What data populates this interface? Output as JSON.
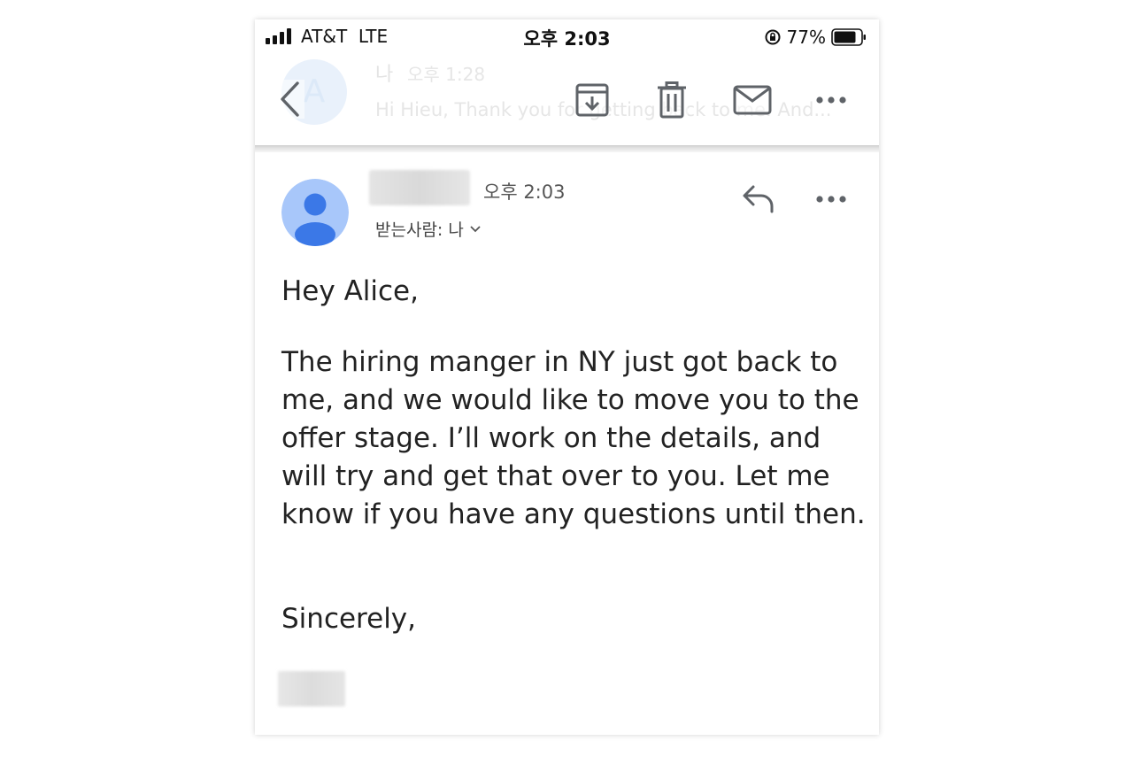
{
  "status_bar": {
    "carrier": "AT&T  LTE",
    "time": "오후 2:03",
    "battery_percent": "77%"
  },
  "toolbar": {
    "background_message": {
      "avatar_letter": "A",
      "sender": "나",
      "time": "오후 1:28",
      "snippet": "Hi Hieu, Thank you for getting back to me. And..."
    },
    "icons": [
      "back-icon",
      "archive-icon",
      "delete-icon",
      "mail-icon",
      "more-icon"
    ]
  },
  "message": {
    "time": "오후 2:03",
    "recipient_label": "받는사람: 나",
    "greeting": "Hey Alice,",
    "body": "The hiring manger in NY just got back to me, and we would like to move you to the offer stage. I’ll work on the details, and will try and get that over to you. Let me know if you have any questions until then.",
    "closing": "Sincerely,"
  },
  "colors": {
    "avatar_bg": "#a8c7fa",
    "avatar_fg": "#3b78e7",
    "icon_gray": "#5f6368",
    "text": "#222222"
  }
}
